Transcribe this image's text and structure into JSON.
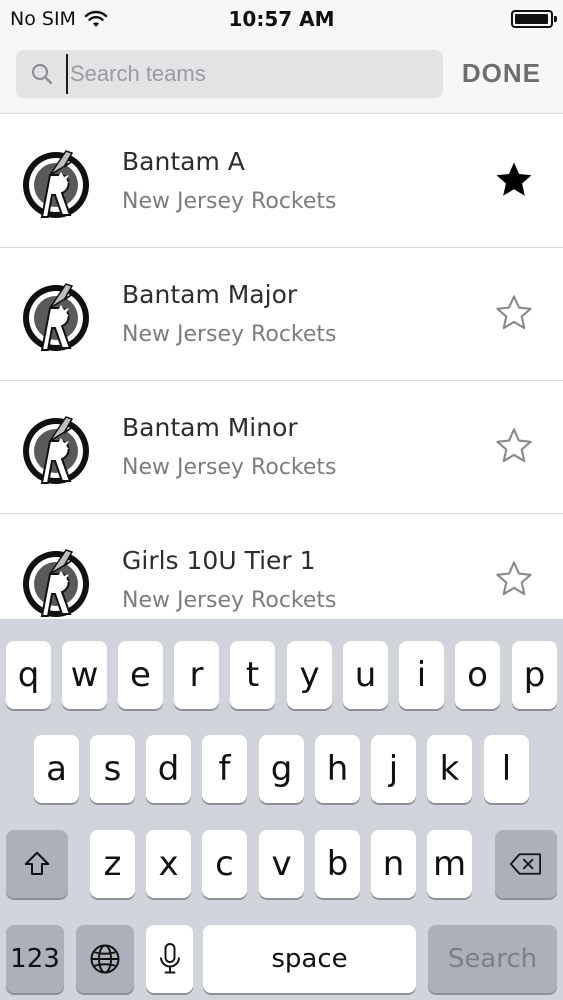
{
  "status_bar": {
    "carrier": "No SIM",
    "time": "10:57 AM"
  },
  "search": {
    "placeholder": "Search teams",
    "value": "",
    "done_label": "DONE"
  },
  "teams": [
    {
      "name": "Bantam A",
      "org": "New Jersey Rockets",
      "favorite": true
    },
    {
      "name": "Bantam Major",
      "org": "New Jersey Rockets",
      "favorite": false
    },
    {
      "name": "Bantam Minor",
      "org": "New Jersey Rockets",
      "favorite": false
    },
    {
      "name": "Girls 10U Tier 1",
      "org": "New Jersey Rockets",
      "favorite": false
    }
  ],
  "keyboard": {
    "row1": [
      "q",
      "w",
      "e",
      "r",
      "t",
      "y",
      "u",
      "i",
      "o",
      "p"
    ],
    "row2": [
      "a",
      "s",
      "d",
      "f",
      "g",
      "h",
      "j",
      "k",
      "l"
    ],
    "row3": [
      "z",
      "x",
      "c",
      "v",
      "b",
      "n",
      "m"
    ],
    "numbers_label": "123",
    "space_label": "space",
    "search_label": "Search"
  },
  "icons": {
    "wifi": "wifi-icon",
    "battery": "battery-icon",
    "search": "search-icon",
    "star_filled": "star-filled-icon",
    "star_outline": "star-outline-icon",
    "shift": "shift-icon",
    "backspace": "backspace-icon",
    "globe": "globe-icon",
    "mic": "microphone-icon"
  }
}
